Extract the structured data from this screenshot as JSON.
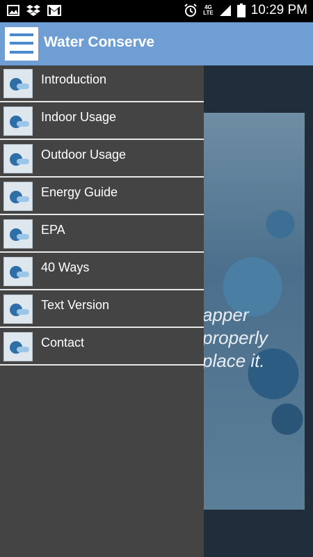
{
  "status_bar": {
    "time": "10:29 PM",
    "network_label": "4G",
    "network_sublabel": "LTE",
    "icons": [
      "image-icon",
      "dropbox-icon",
      "gmail-icon",
      "alarm-icon",
      "signal-icon",
      "battery-icon"
    ]
  },
  "action_bar": {
    "title": "Water Conserve",
    "menu_icon": "hamburger-icon",
    "bg_color": "#6e9ed3"
  },
  "drawer": {
    "items": [
      {
        "label": "Introduction",
        "icon": "app-thumbnail-icon"
      },
      {
        "label": "Indoor Usage",
        "icon": "app-thumbnail-icon"
      },
      {
        "label": "Outdoor Usage",
        "icon": "app-thumbnail-icon"
      },
      {
        "label": "Energy Guide",
        "icon": "app-thumbnail-icon"
      },
      {
        "label": "EPA",
        "icon": "app-thumbnail-icon"
      },
      {
        "label": "40 Ways",
        "icon": "app-thumbnail-icon"
      },
      {
        "label": "Text Version",
        "icon": "app-thumbnail-icon"
      },
      {
        "label": "Contact",
        "icon": "app-thumbnail-icon"
      }
    ]
  },
  "background": {
    "text_lines": [
      "apper",
      "properly",
      "place it."
    ]
  }
}
